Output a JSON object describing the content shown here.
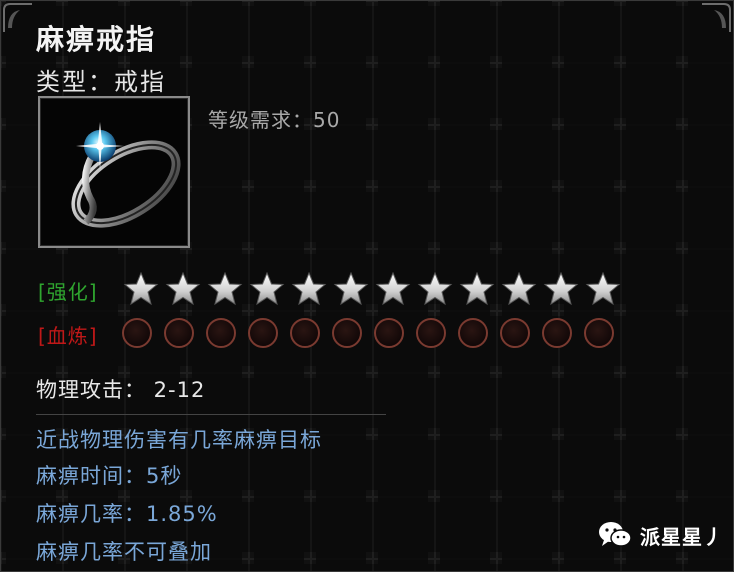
{
  "item": {
    "name": "麻痹戒指",
    "type_label": "类型：",
    "type_value": "戒指",
    "level_requirement": "等级需求：50"
  },
  "enhance": {
    "label": "[强化]",
    "stars_total": 12
  },
  "blood_refine": {
    "label": "[血炼]",
    "slots_total": 12
  },
  "stats": {
    "physical_attack": "物理攻击： 2-12"
  },
  "effects": [
    "近战物理伤害有几率麻痹目标",
    "麻痹时间：5秒",
    "麻痹几率：1.85%",
    "麻痹几率不可叠加"
  ],
  "watermark": {
    "text": "派星星丿",
    "icon": "wechat-icon"
  },
  "colors": {
    "enhance_label": "#2fa52f",
    "blood_label": "#c01818",
    "effect_text": "#7aa7d8"
  }
}
